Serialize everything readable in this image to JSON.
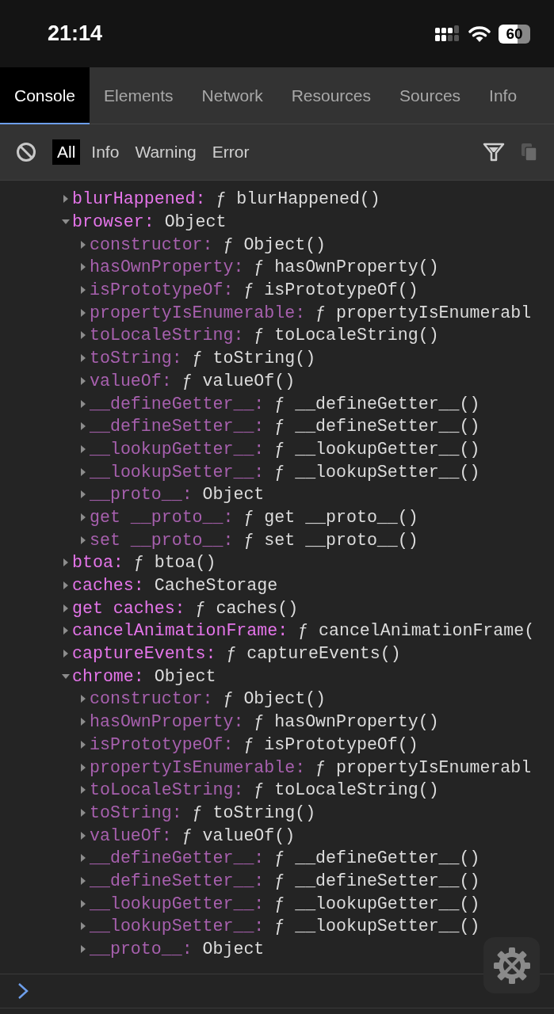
{
  "status_bar": {
    "time": "21:14",
    "battery": "60"
  },
  "tabs": [
    {
      "label": "Console",
      "selected": true
    },
    {
      "label": "Elements",
      "selected": false
    },
    {
      "label": "Network",
      "selected": false
    },
    {
      "label": "Resources",
      "selected": false
    },
    {
      "label": "Sources",
      "selected": false
    },
    {
      "label": "Info",
      "selected": false
    }
  ],
  "filters": [
    {
      "label": "All",
      "selected": true
    },
    {
      "label": "Info",
      "selected": false
    },
    {
      "label": "Warning",
      "selected": false
    },
    {
      "label": "Error",
      "selected": false
    }
  ],
  "properties": [
    {
      "key": "blurHappened:",
      "value": "ƒ blurHappened()",
      "expanded": false
    },
    {
      "key": "browser:",
      "value": "Object",
      "expanded": true,
      "children": [
        {
          "key": "constructor:",
          "value": "ƒ Object()",
          "expanded": false
        },
        {
          "key": "hasOwnProperty:",
          "value": "ƒ hasOwnProperty()",
          "expanded": false
        },
        {
          "key": "isPrototypeOf:",
          "value": "ƒ isPrototypeOf()",
          "expanded": false
        },
        {
          "key": "propertyIsEnumerable:",
          "value": "ƒ propertyIsEnumerabl",
          "expanded": false
        },
        {
          "key": "toLocaleString:",
          "value": "ƒ toLocaleString()",
          "expanded": false
        },
        {
          "key": "toString:",
          "value": "ƒ toString()",
          "expanded": false
        },
        {
          "key": "valueOf:",
          "value": "ƒ valueOf()",
          "expanded": false
        },
        {
          "key": "__defineGetter__:",
          "value": "ƒ __defineGetter__()",
          "expanded": false
        },
        {
          "key": "__defineSetter__:",
          "value": "ƒ __defineSetter__()",
          "expanded": false
        },
        {
          "key": "__lookupGetter__:",
          "value": "ƒ __lookupGetter__()",
          "expanded": false
        },
        {
          "key": "__lookupSetter__:",
          "value": "ƒ __lookupSetter__()",
          "expanded": false
        },
        {
          "key": "__proto__:",
          "value": "Object",
          "expanded": false
        },
        {
          "key": "get __proto__:",
          "value": "ƒ get __proto__()",
          "expanded": false
        },
        {
          "key": "set __proto__:",
          "value": "ƒ set __proto__()",
          "expanded": false
        }
      ]
    },
    {
      "key": "btoa:",
      "value": "ƒ btoa()",
      "expanded": false
    },
    {
      "key": "caches:",
      "value": "CacheStorage",
      "expanded": false
    },
    {
      "key": "get caches:",
      "value": "ƒ caches()",
      "expanded": false
    },
    {
      "key": "cancelAnimationFrame:",
      "value": "ƒ cancelAnimationFrame(",
      "expanded": false
    },
    {
      "key": "captureEvents:",
      "value": "ƒ captureEvents()",
      "expanded": false
    },
    {
      "key": "chrome:",
      "value": "Object",
      "expanded": true,
      "children": [
        {
          "key": "constructor:",
          "value": "ƒ Object()",
          "expanded": false
        },
        {
          "key": "hasOwnProperty:",
          "value": "ƒ hasOwnProperty()",
          "expanded": false
        },
        {
          "key": "isPrototypeOf:",
          "value": "ƒ isPrototypeOf()",
          "expanded": false
        },
        {
          "key": "propertyIsEnumerable:",
          "value": "ƒ propertyIsEnumerabl",
          "expanded": false
        },
        {
          "key": "toLocaleString:",
          "value": "ƒ toLocaleString()",
          "expanded": false
        },
        {
          "key": "toString:",
          "value": "ƒ toString()",
          "expanded": false
        },
        {
          "key": "valueOf:",
          "value": "ƒ valueOf()",
          "expanded": false
        },
        {
          "key": "__defineGetter__:",
          "value": "ƒ __defineGetter__()",
          "expanded": false
        },
        {
          "key": "__defineSetter__:",
          "value": "ƒ __defineSetter__()",
          "expanded": false
        },
        {
          "key": "__lookupGetter__:",
          "value": "ƒ __lookupGetter__()",
          "expanded": false
        },
        {
          "key": "__lookupSetter__:",
          "value": "ƒ __lookupSetter__()",
          "expanded": false
        },
        {
          "key": "__proto__:",
          "value": "Object",
          "expanded": false
        }
      ]
    }
  ]
}
